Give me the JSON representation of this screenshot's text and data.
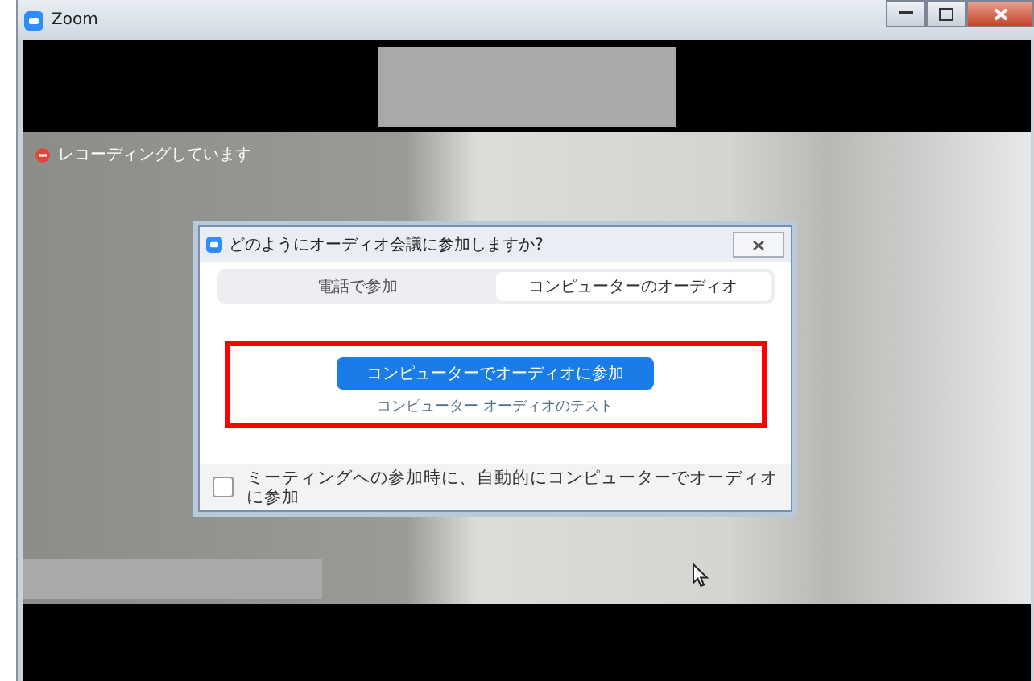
{
  "window": {
    "title": "Zoom"
  },
  "recording_indicator": {
    "label": "レコーディングしています"
  },
  "audio_dialog": {
    "title": "どのようにオーディオ会議に参加しますか?",
    "tabs": [
      {
        "label": "電話で参加",
        "selected": false
      },
      {
        "label": "コンピューターのオーディオ",
        "selected": true
      }
    ],
    "join_button": "コンピューターでオーディオに参加",
    "test_link": "コンピューター オーディオのテスト",
    "auto_join_checkbox": {
      "label": "ミーティングへの参加時に、自動的にコンピューターでオーディオに参加",
      "checked": false
    }
  }
}
